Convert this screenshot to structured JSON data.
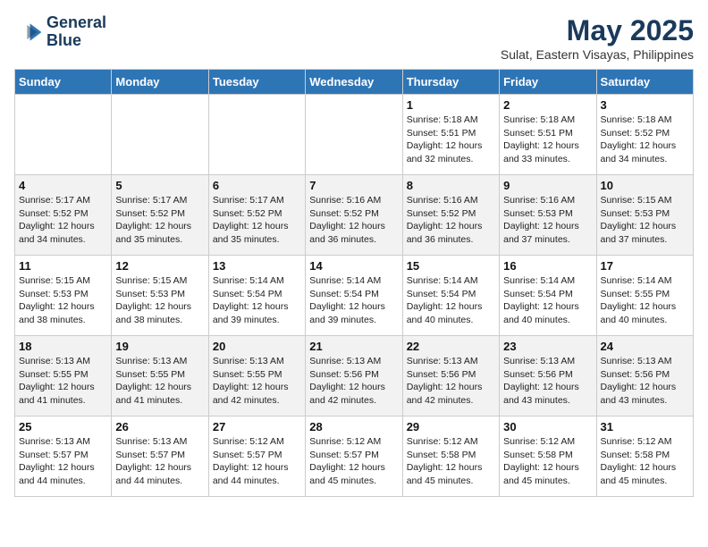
{
  "logo": {
    "line1": "General",
    "line2": "Blue"
  },
  "title": "May 2025",
  "subtitle": "Sulat, Eastern Visayas, Philippines",
  "weekdays": [
    "Sunday",
    "Monday",
    "Tuesday",
    "Wednesday",
    "Thursday",
    "Friday",
    "Saturday"
  ],
  "weeks": [
    [
      {
        "day": "",
        "info": ""
      },
      {
        "day": "",
        "info": ""
      },
      {
        "day": "",
        "info": ""
      },
      {
        "day": "",
        "info": ""
      },
      {
        "day": "1",
        "info": "Sunrise: 5:18 AM\nSunset: 5:51 PM\nDaylight: 12 hours\nand 32 minutes."
      },
      {
        "day": "2",
        "info": "Sunrise: 5:18 AM\nSunset: 5:51 PM\nDaylight: 12 hours\nand 33 minutes."
      },
      {
        "day": "3",
        "info": "Sunrise: 5:18 AM\nSunset: 5:52 PM\nDaylight: 12 hours\nand 34 minutes."
      }
    ],
    [
      {
        "day": "4",
        "info": "Sunrise: 5:17 AM\nSunset: 5:52 PM\nDaylight: 12 hours\nand 34 minutes."
      },
      {
        "day": "5",
        "info": "Sunrise: 5:17 AM\nSunset: 5:52 PM\nDaylight: 12 hours\nand 35 minutes."
      },
      {
        "day": "6",
        "info": "Sunrise: 5:17 AM\nSunset: 5:52 PM\nDaylight: 12 hours\nand 35 minutes."
      },
      {
        "day": "7",
        "info": "Sunrise: 5:16 AM\nSunset: 5:52 PM\nDaylight: 12 hours\nand 36 minutes."
      },
      {
        "day": "8",
        "info": "Sunrise: 5:16 AM\nSunset: 5:52 PM\nDaylight: 12 hours\nand 36 minutes."
      },
      {
        "day": "9",
        "info": "Sunrise: 5:16 AM\nSunset: 5:53 PM\nDaylight: 12 hours\nand 37 minutes."
      },
      {
        "day": "10",
        "info": "Sunrise: 5:15 AM\nSunset: 5:53 PM\nDaylight: 12 hours\nand 37 minutes."
      }
    ],
    [
      {
        "day": "11",
        "info": "Sunrise: 5:15 AM\nSunset: 5:53 PM\nDaylight: 12 hours\nand 38 minutes."
      },
      {
        "day": "12",
        "info": "Sunrise: 5:15 AM\nSunset: 5:53 PM\nDaylight: 12 hours\nand 38 minutes."
      },
      {
        "day": "13",
        "info": "Sunrise: 5:14 AM\nSunset: 5:54 PM\nDaylight: 12 hours\nand 39 minutes."
      },
      {
        "day": "14",
        "info": "Sunrise: 5:14 AM\nSunset: 5:54 PM\nDaylight: 12 hours\nand 39 minutes."
      },
      {
        "day": "15",
        "info": "Sunrise: 5:14 AM\nSunset: 5:54 PM\nDaylight: 12 hours\nand 40 minutes."
      },
      {
        "day": "16",
        "info": "Sunrise: 5:14 AM\nSunset: 5:54 PM\nDaylight: 12 hours\nand 40 minutes."
      },
      {
        "day": "17",
        "info": "Sunrise: 5:14 AM\nSunset: 5:55 PM\nDaylight: 12 hours\nand 40 minutes."
      }
    ],
    [
      {
        "day": "18",
        "info": "Sunrise: 5:13 AM\nSunset: 5:55 PM\nDaylight: 12 hours\nand 41 minutes."
      },
      {
        "day": "19",
        "info": "Sunrise: 5:13 AM\nSunset: 5:55 PM\nDaylight: 12 hours\nand 41 minutes."
      },
      {
        "day": "20",
        "info": "Sunrise: 5:13 AM\nSunset: 5:55 PM\nDaylight: 12 hours\nand 42 minutes."
      },
      {
        "day": "21",
        "info": "Sunrise: 5:13 AM\nSunset: 5:56 PM\nDaylight: 12 hours\nand 42 minutes."
      },
      {
        "day": "22",
        "info": "Sunrise: 5:13 AM\nSunset: 5:56 PM\nDaylight: 12 hours\nand 42 minutes."
      },
      {
        "day": "23",
        "info": "Sunrise: 5:13 AM\nSunset: 5:56 PM\nDaylight: 12 hours\nand 43 minutes."
      },
      {
        "day": "24",
        "info": "Sunrise: 5:13 AM\nSunset: 5:56 PM\nDaylight: 12 hours\nand 43 minutes."
      }
    ],
    [
      {
        "day": "25",
        "info": "Sunrise: 5:13 AM\nSunset: 5:57 PM\nDaylight: 12 hours\nand 44 minutes."
      },
      {
        "day": "26",
        "info": "Sunrise: 5:13 AM\nSunset: 5:57 PM\nDaylight: 12 hours\nand 44 minutes."
      },
      {
        "day": "27",
        "info": "Sunrise: 5:12 AM\nSunset: 5:57 PM\nDaylight: 12 hours\nand 44 minutes."
      },
      {
        "day": "28",
        "info": "Sunrise: 5:12 AM\nSunset: 5:57 PM\nDaylight: 12 hours\nand 45 minutes."
      },
      {
        "day": "29",
        "info": "Sunrise: 5:12 AM\nSunset: 5:58 PM\nDaylight: 12 hours\nand 45 minutes."
      },
      {
        "day": "30",
        "info": "Sunrise: 5:12 AM\nSunset: 5:58 PM\nDaylight: 12 hours\nand 45 minutes."
      },
      {
        "day": "31",
        "info": "Sunrise: 5:12 AM\nSunset: 5:58 PM\nDaylight: 12 hours\nand 45 minutes."
      }
    ]
  ]
}
